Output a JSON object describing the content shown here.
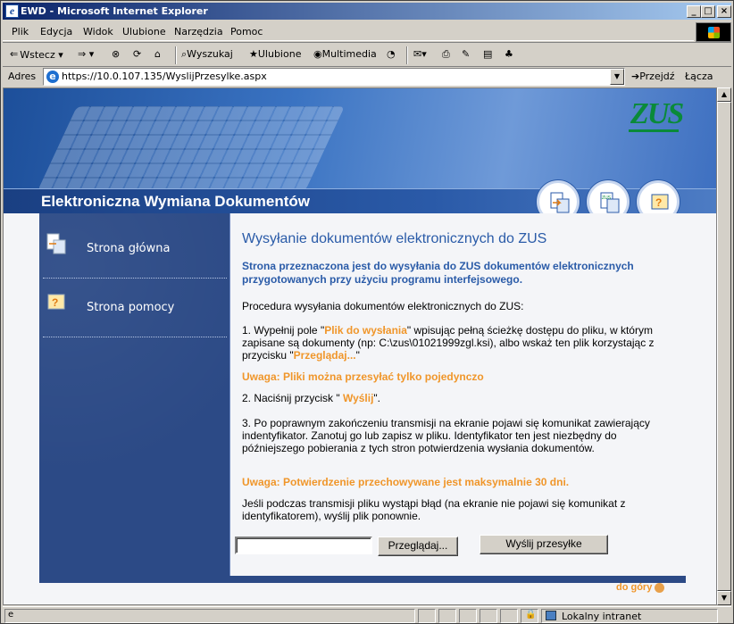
{
  "window": {
    "title": "EWD - Microsoft Internet Explorer"
  },
  "menu": [
    "Plik",
    "Edycja",
    "Widok",
    "Ulubione",
    "Narzędzia",
    "Pomoc"
  ],
  "toolbar": {
    "back": "Wstecz",
    "search": "Wyszukaj",
    "favorites": "Ulubione",
    "media": "Multimedia"
  },
  "address": {
    "label": "Adres",
    "url": "https://10.0.107.135/WyslijPrzesylke.aspx",
    "go": "Przejdź",
    "links": "Łącza"
  },
  "banner": {
    "title": "Elektroniczna Wymiana Dokumentów",
    "logo": "ZUS"
  },
  "sidebar": {
    "items": [
      {
        "label": "Strona główna",
        "icon": "document-arrow-icon"
      },
      {
        "label": "Strona pomocy",
        "icon": "help-icon"
      }
    ]
  },
  "content": {
    "title": "Wysyłanie dokumentów elektronicznych do ZUS",
    "intro": "Strona przeznaczona jest do wysyłania do ZUS dokumentów elektronicznych przygotowanych przy użyciu programu interfejsowego.",
    "procedure": "Procedura wysyłania dokumentów elektronicznych do ZUS:",
    "step1_a": "1. Wypełnij pole \"",
    "step1_field": "Plik do wysłania",
    "step1_b": "\" wpisując pełną ścieżkę dostępu do pliku, w którym zapisane są dokumenty (np: C:\\zus\\01021999zgl.ksi), albo wskaż ten plik korzystając z przycisku \"",
    "step1_btn": "Przeglądaj...",
    "step1_c": "\"",
    "warn1": "Uwaga: Pliki można przesyłać tylko pojedynczo",
    "step2_a": "2. Naciśnij przycisk \" ",
    "step2_btn": "Wyślij",
    "step2_b": "\".",
    "step3": "3. Po poprawnym zakończeniu transmisji na ekranie pojawi się komunikat zawierający indentyfikator. Zanotuj go lub zapisz w pliku. Identyfikator ten jest niezbędny do późniejszego pobierania z tych stron potwierdzenia wysłania dokumentów.",
    "warn2": "Uwaga: Potwierdzenie przechowywane jest maksymalnie 30 dni.",
    "error_note": "Jeśli podczas transmisji pliku wystąpi błąd (na ekranie nie pojawi się komunikat z identyfikatorem), wyślij plik ponownie.",
    "file_value": "",
    "browse_label": "Przeglądaj...",
    "send_label": "Wyślij przesyłke"
  },
  "footer": {
    "top_link": "do góry"
  },
  "status": {
    "zone": "Lokalny intranet"
  }
}
